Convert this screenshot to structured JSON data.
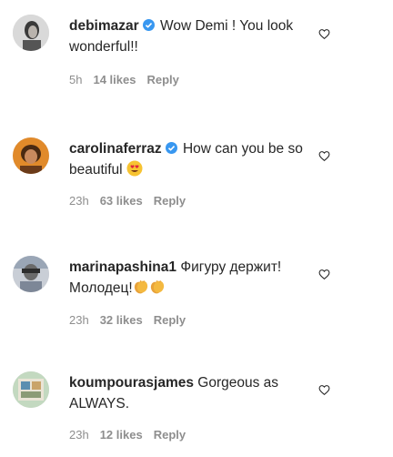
{
  "comments": [
    {
      "username": "debimazar",
      "verified": true,
      "text": "Wow Demi ! You look wonderful!!",
      "time": "5h",
      "likes": "14 likes",
      "reply": "Reply"
    },
    {
      "username": "carolinaferraz",
      "verified": true,
      "text": "How can you be so beautiful",
      "emoji": "heart-eyes-emoji",
      "time": "23h",
      "likes": "63 likes",
      "reply": "Reply"
    },
    {
      "username": "marinapashina1",
      "verified": false,
      "text": "Фигуру держит! Молодец!",
      "emoji": "clapping-hands-emoji",
      "time": "23h",
      "likes": "32 likes",
      "reply": "Reply"
    },
    {
      "username": "koumpourasjames",
      "verified": false,
      "text": "Gorgeous as ALWAYS.",
      "time": "23h",
      "likes": "12 likes",
      "reply": "Reply"
    }
  ],
  "colors": {
    "verified_badge": "#3897f0",
    "text": "#262626",
    "meta": "#8e8e8e"
  }
}
